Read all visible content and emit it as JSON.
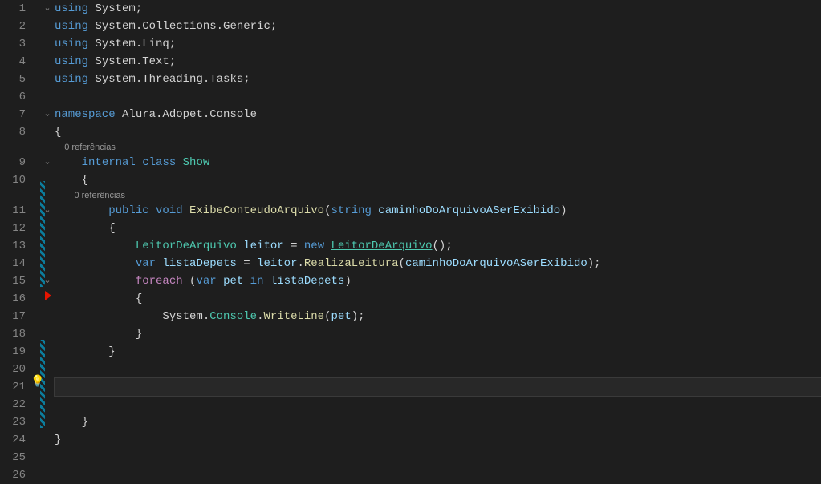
{
  "lineNumbers": [
    "1",
    "2",
    "3",
    "4",
    "5",
    "6",
    "7",
    "8",
    "",
    "9",
    "10",
    "",
    "11",
    "12",
    "13",
    "14",
    "15",
    "16",
    "17",
    "18",
    "19",
    "20",
    "21",
    "22",
    "23",
    "24",
    "25",
    "26"
  ],
  "codelens": {
    "class": "0 referências",
    "method": "0 referências"
  },
  "code": {
    "l1_using": "using",
    "l1_ns": " System",
    "l1_semi": ";",
    "l2_using": "using",
    "l2_ns": " System",
    "l2_dot": ".Collections.Generic",
    "l2_semi": ";",
    "l3_using": "using",
    "l3_ns": " System",
    "l3_dot": ".Linq",
    "l3_semi": ";",
    "l4_using": "using",
    "l4_ns": " System",
    "l4_dot": ".Text",
    "l4_semi": ";",
    "l5_using": "using",
    "l5_ns": " System",
    "l5_dot": ".Threading.Tasks",
    "l5_semi": ";",
    "l7_namespace": "namespace",
    "l7_nsname": " Alura.Adopet.Console",
    "l8_brace": "{",
    "l9_internal": "internal ",
    "l9_class": "class ",
    "l9_name": "Show",
    "l10_brace": "{",
    "l11_public": "public ",
    "l11_void": "void ",
    "l11_method": "ExibeConteudoArquivo",
    "l11_paren_o": "(",
    "l11_string": "string ",
    "l11_param": "caminhoDoArquivoASerExibido",
    "l11_paren_c": ")",
    "l12_brace": "{",
    "l13_type": "LeitorDeArquivo ",
    "l13_var": "leitor",
    "l13_eq": " = ",
    "l13_new": "new ",
    "l13_type2": "LeitorDeArquivo",
    "l13_paren": "();",
    "l14_var": "var ",
    "l14_name": "listaDepets",
    "l14_eq": " = ",
    "l14_obj": "leitor",
    "l14_dot": ".",
    "l14_method": "RealizaLeitura",
    "l14_p1": "(",
    "l14_arg": "caminhoDoArquivoASerExibido",
    "l14_p2": ");",
    "l15_foreach": "foreach ",
    "l15_p1": "(",
    "l15_var": "var ",
    "l15_pet": "pet",
    "l15_in": " in ",
    "l15_list": "listaDepets",
    "l15_p2": ")",
    "l16_brace": "{",
    "l17_sys": "System",
    "l17_dot1": ".",
    "l17_cons": "Console",
    "l17_dot2": ".",
    "l17_wl": "WriteLine",
    "l17_p1": "(",
    "l17_arg": "pet",
    "l17_p2": ");",
    "l18_brace": "}",
    "l19_brace": "}",
    "l23_brace": "}",
    "l24_brace": "}"
  },
  "icons": {
    "fold_open": "⌄",
    "bulb": "💡"
  }
}
